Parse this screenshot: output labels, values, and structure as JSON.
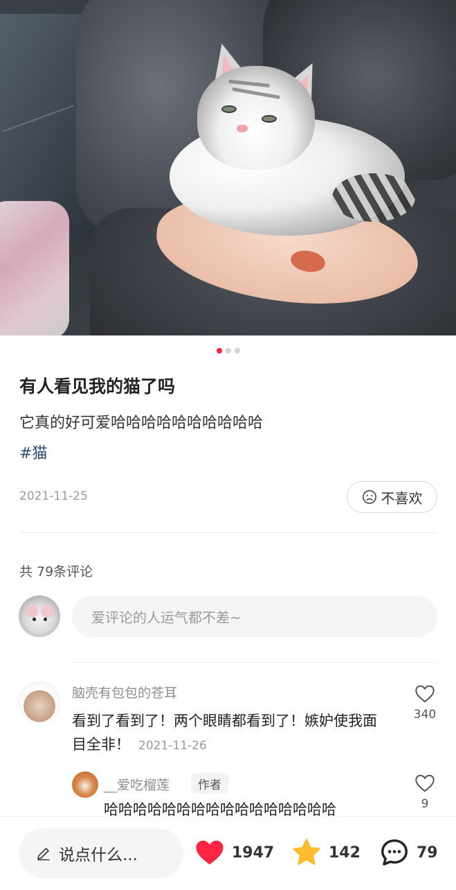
{
  "post": {
    "title": "有人看见我的猫了吗",
    "description": "它真的好可爱哈哈哈哈哈哈哈哈哈哈",
    "hashtag": "#猫",
    "date": "2021-11-25",
    "dislike_label": "不喜欢",
    "image_count": 3,
    "current_image": 1
  },
  "comments_section": {
    "count_label": "共 79条评论",
    "input_placeholder": "爱评论的人运气都不差~"
  },
  "comments": [
    {
      "user": "脑壳有包包的苍耳",
      "text": "看到了看到了！两个眼睛都看到了！嫉妒使我面目全非！",
      "date": "2021-11-26",
      "likes": "340",
      "reply": {
        "user": "__爱吃榴莲",
        "tag": "作者",
        "text": "哈哈哈哈哈哈哈哈哈哈哈哈哈哈哈哈",
        "likes": "9"
      }
    }
  ],
  "bottom_bar": {
    "say_label": "说点什么...",
    "likes": "1947",
    "favorites": "142",
    "comments": "79"
  },
  "colors": {
    "accent": "#ff2442",
    "star": "#fdbb2d",
    "hashtag": "#2c4a79"
  },
  "icons": [
    "pencil-icon",
    "heart-icon",
    "star-icon",
    "comment-bubble-icon",
    "sad-face-icon",
    "heart-outline-icon"
  ]
}
